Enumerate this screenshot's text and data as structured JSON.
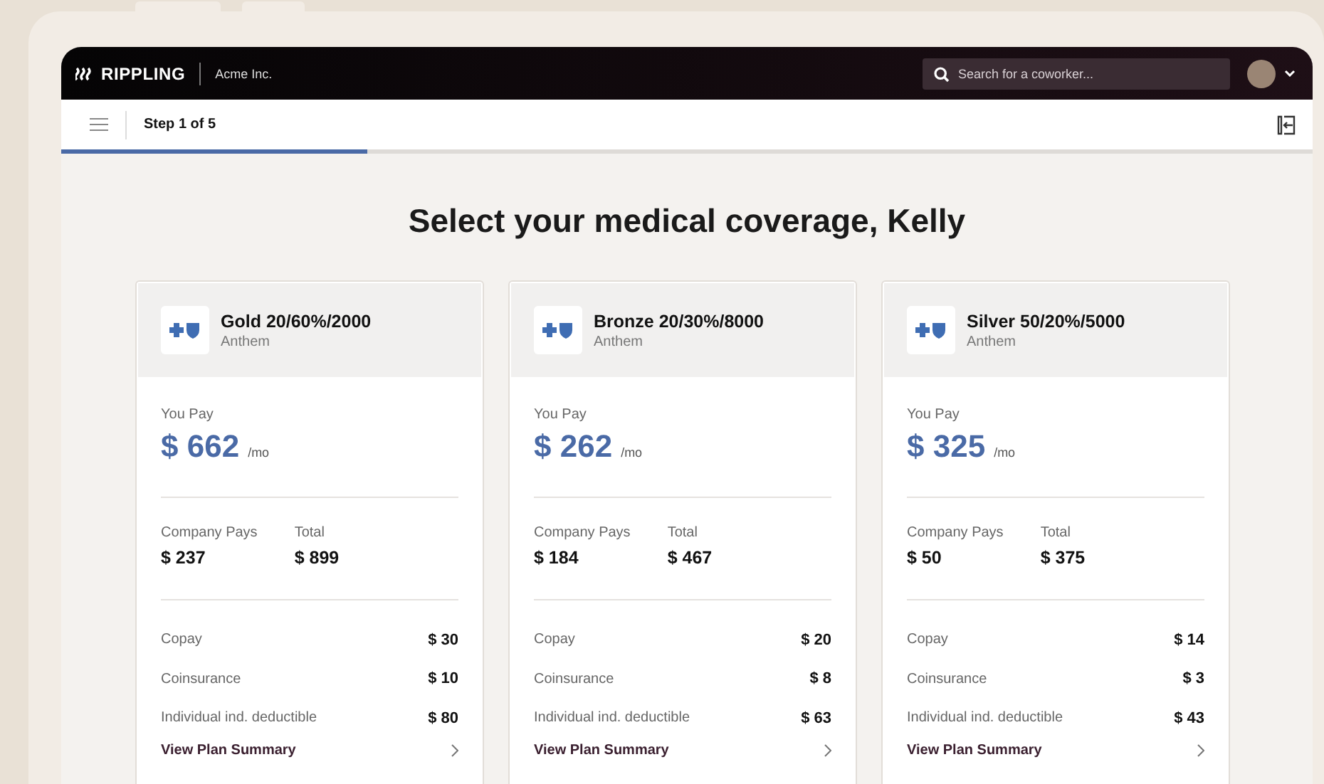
{
  "topbar": {
    "brand": "RIPPLING",
    "company": "Acme Inc.",
    "search": {
      "placeholder": "Search for a coworker..."
    }
  },
  "stepbar": {
    "step": "Step 1 of 5",
    "progress": {
      "level": 0.245
    }
  },
  "title": "Select your medical coverage, Kelly",
  "plans": [
    {
      "name": "Gold 20/60%/2000",
      "carrier": "Anthem",
      "you_pay_label": "You Pay",
      "you_pay": "$ 662",
      "per": "/mo",
      "company_pays_label": "Company Pays",
      "company_pays": "$ 237",
      "total_label": "Total",
      "total": "$ 899",
      "details": [
        {
          "label": "Copay",
          "value": "$ 30"
        },
        {
          "label": "Coinsurance",
          "value": "$ 10"
        },
        {
          "label": "Individual ind. deductible",
          "value": "$ 80"
        }
      ],
      "link": "View Plan Summary"
    },
    {
      "name": "Bronze 20/30%/8000",
      "carrier": "Anthem",
      "you_pay_label": "You Pay",
      "you_pay": "$ 262",
      "per": "/mo",
      "company_pays_label": "Company Pays",
      "company_pays": "$ 184",
      "total_label": "Total",
      "total": "$ 467",
      "details": [
        {
          "label": "Copay",
          "value": "$ 20"
        },
        {
          "label": "Coinsurance",
          "value": "$ 8"
        },
        {
          "label": "Individual ind. deductible",
          "value": "$ 63"
        }
      ],
      "link": "View Plan Summary"
    },
    {
      "name": "Silver 50/20%/5000",
      "carrier": "Anthem",
      "you_pay_label": "You Pay",
      "you_pay": "$ 325",
      "per": "/mo",
      "company_pays_label": "Company Pays",
      "company_pays": "$ 50",
      "total_label": "Total",
      "total": "$ 375",
      "details": [
        {
          "label": "Copay",
          "value": "$ 14"
        },
        {
          "label": "Coinsurance",
          "value": "$ 3"
        },
        {
          "label": "Individual ind. deductible",
          "value": "$ 43"
        }
      ],
      "link": "View Plan Summary"
    }
  ]
}
